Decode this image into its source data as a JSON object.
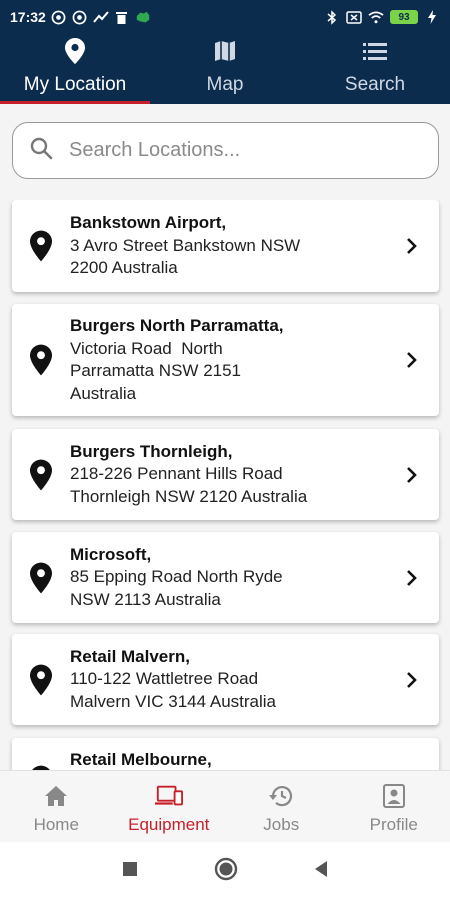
{
  "status_bar": {
    "time": "17:32",
    "battery": "93",
    "icons_left": [
      "whatsapp-icon",
      "whatsapp-icon",
      "trending-icon",
      "trash-icon",
      "australia-map-icon"
    ],
    "icons_right": [
      "bluetooth-icon",
      "sim-icon",
      "wifi-icon",
      "battery-icon",
      "charging-icon"
    ]
  },
  "tabs": [
    {
      "label": "My Location",
      "icon": "location-pin-icon",
      "active": true
    },
    {
      "label": "Map",
      "icon": "map-icon",
      "active": false
    },
    {
      "label": "Search",
      "icon": "list-icon",
      "active": false
    }
  ],
  "search": {
    "placeholder": "Search Locations...",
    "value": ""
  },
  "locations": [
    {
      "name": "Bankstown Airport,",
      "address_lines": [
        "3 Avro Street Bankstown NSW",
        "2200 Australia"
      ]
    },
    {
      "name": "Burgers North Parramatta,",
      "address_lines": [
        "Victoria Road  North",
        "Parramatta NSW 2151",
        "Australia"
      ]
    },
    {
      "name": "Burgers Thornleigh,",
      "address_lines": [
        "218-226 Pennant Hills Road",
        "Thornleigh NSW 2120 Australia"
      ]
    },
    {
      "name": "Microsoft,",
      "address_lines": [
        "85 Epping Road North Ryde",
        "NSW 2113 Australia"
      ]
    },
    {
      "name": "Retail Malvern,",
      "address_lines": [
        "110-122 Wattletree Road",
        "Malvern VIC 3144 Australia"
      ]
    },
    {
      "name": "Retail Melbourne,",
      "address_lines": []
    }
  ],
  "bottom_nav": [
    {
      "label": "Home",
      "icon": "home-icon",
      "active": false
    },
    {
      "label": "Equipment",
      "icon": "devices-icon",
      "active": true
    },
    {
      "label": "Jobs",
      "icon": "history-icon",
      "active": false
    },
    {
      "label": "Profile",
      "icon": "profile-icon",
      "active": false
    }
  ],
  "colors": {
    "header_bg": "#0b2c4d",
    "accent": "#c8202a",
    "inactive": "#888888"
  }
}
